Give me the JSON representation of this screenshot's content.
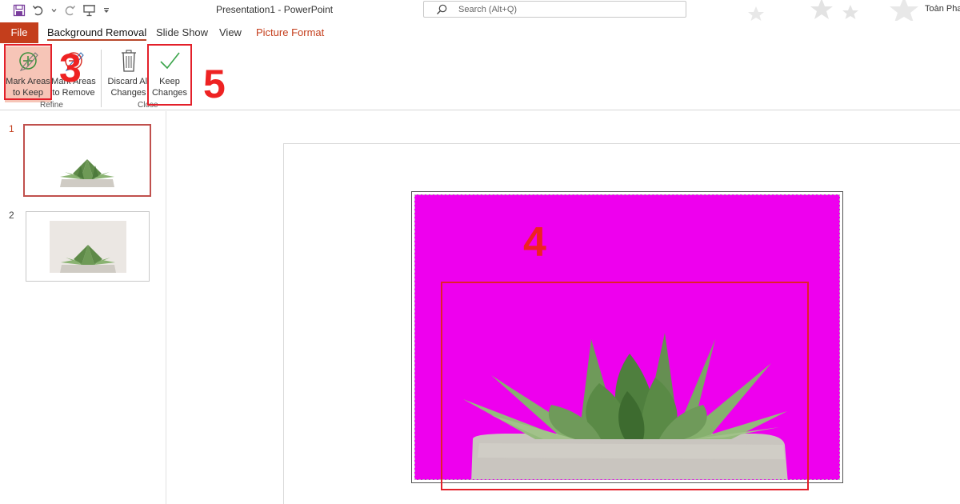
{
  "window": {
    "title": "Presentation1  -  PowerPoint",
    "search_placeholder": "Search (Alt+Q)",
    "user_name": "Toàn Pha"
  },
  "quick_access": {
    "icons": [
      "save-icon",
      "undo-icon",
      "undo-dropdown-icon",
      "redo-icon",
      "present-icon",
      "customize-qat-icon"
    ]
  },
  "tabs": {
    "file": "File",
    "background_removal": "Background Removal",
    "slide_show": "Slide Show",
    "view": "View",
    "picture_format": "Picture Format"
  },
  "ribbon": {
    "mark_keep": {
      "line1": "Mark Areas",
      "line2": "to Keep",
      "icon": "pencil-plus-icon"
    },
    "mark_remove": {
      "line1": "Mark Areas",
      "line2": "to Remove",
      "icon": "pencil-minus-icon"
    },
    "discard": {
      "line1": "Discard All",
      "line2": "Changes",
      "icon": "trash-icon"
    },
    "keep_changes": {
      "line1": "Keep",
      "line2": "Changes",
      "icon": "checkmark-icon"
    },
    "group_refine": "Refine",
    "group_close": "Close"
  },
  "annotations": {
    "step3": "3",
    "step4": "4",
    "step5": "5"
  },
  "thumbnails": [
    {
      "number": "1",
      "selected": true
    },
    {
      "number": "2",
      "selected": false
    }
  ],
  "colors": {
    "accent": "#c43e1c",
    "annotation": "#e3202a",
    "removal_mask": "#ee00ee",
    "keep_highlight": "#f6c5b7"
  }
}
